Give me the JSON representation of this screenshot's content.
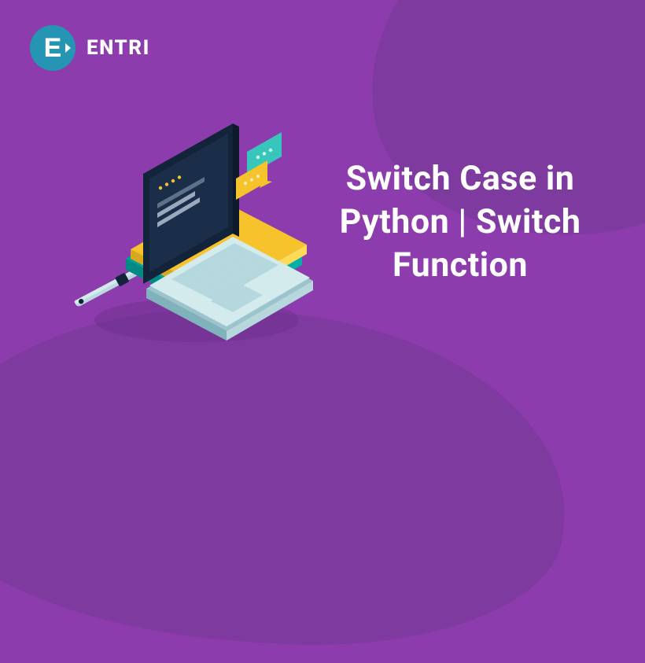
{
  "logo": {
    "letter": "E",
    "text": "ENTRI"
  },
  "title": "Switch Case in Python | Switch Function",
  "illustration": {
    "name": "laptop-illustration",
    "laptop_color_body": "#b4d8de",
    "laptop_color_body_light": "#d4ebee",
    "laptop_screen_bezel": "#13243a",
    "laptop_screen_dark": "#1a2e49",
    "book_teal": "#01a19a",
    "book_yellow": "#f7c32d",
    "pen_body": "#bcd8de",
    "pen_tip": "#13243a",
    "line_yellow": "#f7c32d",
    "line_grey": "#5d718a",
    "bubble_teal": "#38c6bc",
    "bubble_yellow": "#f7c32d",
    "dot": "#cfd8e2"
  }
}
